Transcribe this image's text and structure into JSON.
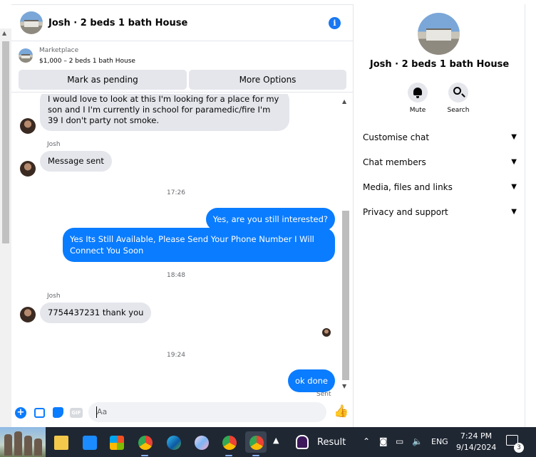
{
  "header": {
    "title": "Josh · 2 beds 1 bath House"
  },
  "marketplace": {
    "label": "Marketplace",
    "listing": "$1,000 – 2 beds 1 bath House",
    "mark_pending_label": "Mark as pending",
    "more_options_label": "More Options"
  },
  "messages": {
    "msg1_text": "I would love to look at this I'm looking for a place for my son and I I'm currently in school for paramedic/fire I'm 39 I don't party not smoke.",
    "sender1": "Josh",
    "msg2_text": "Message sent",
    "time1": "17:26",
    "out1_text": "Yes, are you still interested?",
    "out2_text": "Yes Its Still Available, Please Send Your Phone Number I Will Connect You Soon",
    "time2": "18:48",
    "sender2": "Josh",
    "msg3_text": "7754437231 thank you",
    "time3": "19:24",
    "out3_text": "ok done",
    "status": "Sent"
  },
  "composer": {
    "placeholder": "Aa",
    "gif_label": "GIF"
  },
  "right_panel": {
    "title": "Josh · 2 beds 1 bath House",
    "mute_label": "Mute",
    "search_label": "Search",
    "sections": [
      "Customise chat",
      "Chat members",
      "Media, files and links",
      "Privacy and support"
    ]
  },
  "taskbar": {
    "news_label": "Result",
    "language": "ENG",
    "time": "7:24 PM",
    "date": "9/14/2024",
    "notification_count": "3"
  },
  "colors": {
    "accent": "#0a7cff",
    "incoming_bubble": "#e4e6eb",
    "taskbar": "#1f2733"
  }
}
